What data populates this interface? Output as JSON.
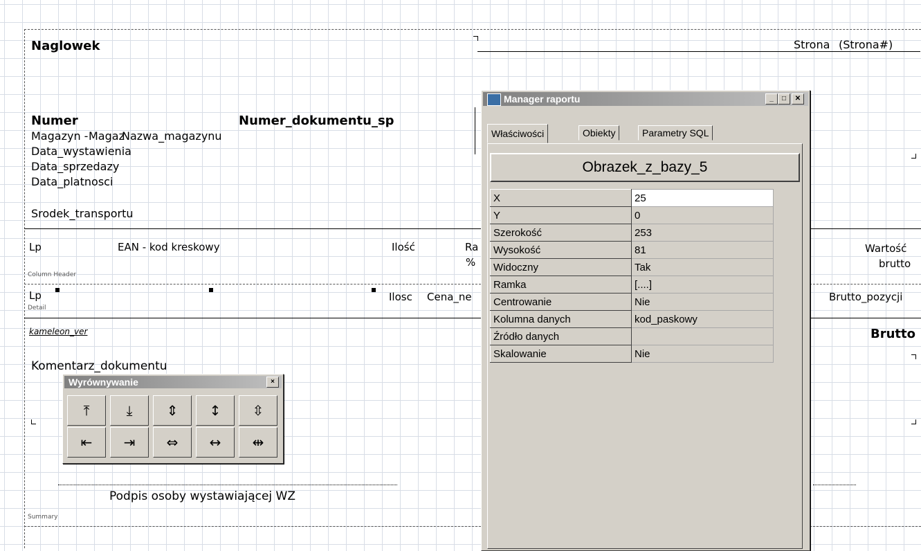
{
  "report": {
    "header_band": "Naglowek",
    "page_label": "Strona",
    "page_field": "(Strona#)",
    "numer_label": "Numer",
    "numer_dok": "Numer_dokumentu_sp",
    "magazyn_label": "Magazyn -",
    "magaz": "Magaz",
    "nazwa_magazynu": "Nazwa_magazynu",
    "data_wystawienia": "Data_wystawienia",
    "data_sprzedazy": "Data_sprzedazy",
    "data_platnosci": "Data_platnosci",
    "srodek_transportu": "Srodek_transportu",
    "col_lp": "Lp",
    "col_ean": "EAN - kod kreskowy",
    "col_ilosc": "Ilość",
    "col_ra": "Ra",
    "col_pct": "%",
    "col_wartosc": "Wartość",
    "col_brutto": "brutto",
    "column_header_band": "Column Header",
    "detail_lp": "Lp",
    "detail_band": "Detail",
    "detail_ilosc": "Ilosc",
    "detail_cena": "Cena_ne",
    "detail_brutto_poz": "Brutto_pozycji",
    "kameleon": "kameleon_ver",
    "brutto_total": "Brutto",
    "komentarz": "Komentarz_dokumentu",
    "podpis": "Podpis osoby wystawiającej WZ",
    "summary_band": "Summary"
  },
  "manager": {
    "title": "Manager raportu",
    "tabs": [
      "Właściwości",
      "Obiekty",
      "Parametry SQL"
    ],
    "object_name": "Obrazek_z_bazy_5",
    "properties": [
      {
        "name": "X",
        "value": "25"
      },
      {
        "name": "Y",
        "value": "0"
      },
      {
        "name": "Szerokość",
        "value": "253"
      },
      {
        "name": "Wysokość",
        "value": "81"
      },
      {
        "name": "Widoczny",
        "value": "Tak"
      },
      {
        "name": "Ramka",
        "value": "[....]"
      },
      {
        "name": "Centrowanie",
        "value": "Nie"
      },
      {
        "name": "Kolumna danych",
        "value": "kod_paskowy"
      },
      {
        "name": "Źródło danych",
        "value": ""
      },
      {
        "name": "Skalowanie",
        "value": "Nie"
      }
    ]
  },
  "align": {
    "title": "Wyrównywanie",
    "close": "×",
    "tools_row1": [
      "align-top-icon",
      "align-bottom-icon",
      "align-vcenter-icon",
      "same-height-icon",
      "space-vert-icon"
    ],
    "tools_row2": [
      "align-left-icon",
      "align-right-icon",
      "align-hcenter-icon",
      "same-width-icon",
      "space-horz-icon"
    ]
  },
  "colors": {
    "titlebar_start": "#808080",
    "titlebar_end": "#c0c0c0",
    "face": "#d4d0c8"
  }
}
